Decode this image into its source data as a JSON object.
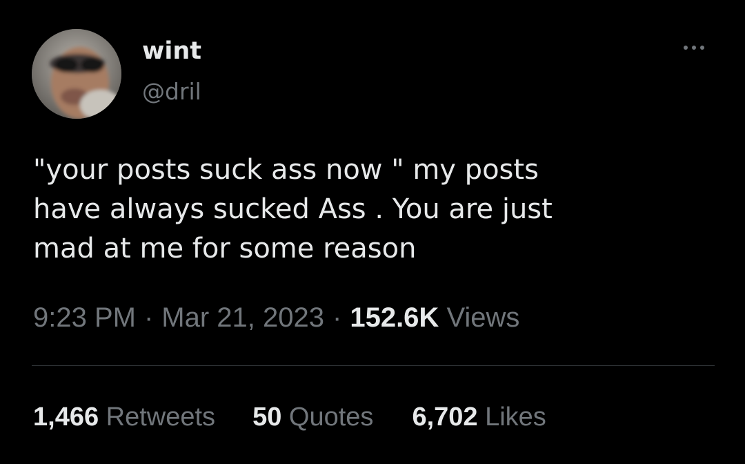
{
  "tweet": {
    "author": {
      "display_name": "wint",
      "handle": "@dril",
      "avatar": "avatar-photo"
    },
    "more_icon": "more-horizontal-icon",
    "text_lines": [
      "\"your posts suck ass now \" my posts",
      "have always sucked Ass . You are just",
      "mad at me for some reason"
    ],
    "meta": {
      "time": "9:23 PM",
      "separator": "·",
      "date": "Mar 21, 2023",
      "views_count": "152.6K",
      "views_label": "Views"
    },
    "stats": {
      "retweets_count": "1,466",
      "retweets_label": "Retweets",
      "quotes_count": "50",
      "quotes_label": "Quotes",
      "likes_count": "6,702",
      "likes_label": "Likes"
    }
  },
  "colors": {
    "background": "#000000",
    "primary_text": "#e7e9ea",
    "secondary_text": "#71767b",
    "divider": "#2f3336"
  }
}
